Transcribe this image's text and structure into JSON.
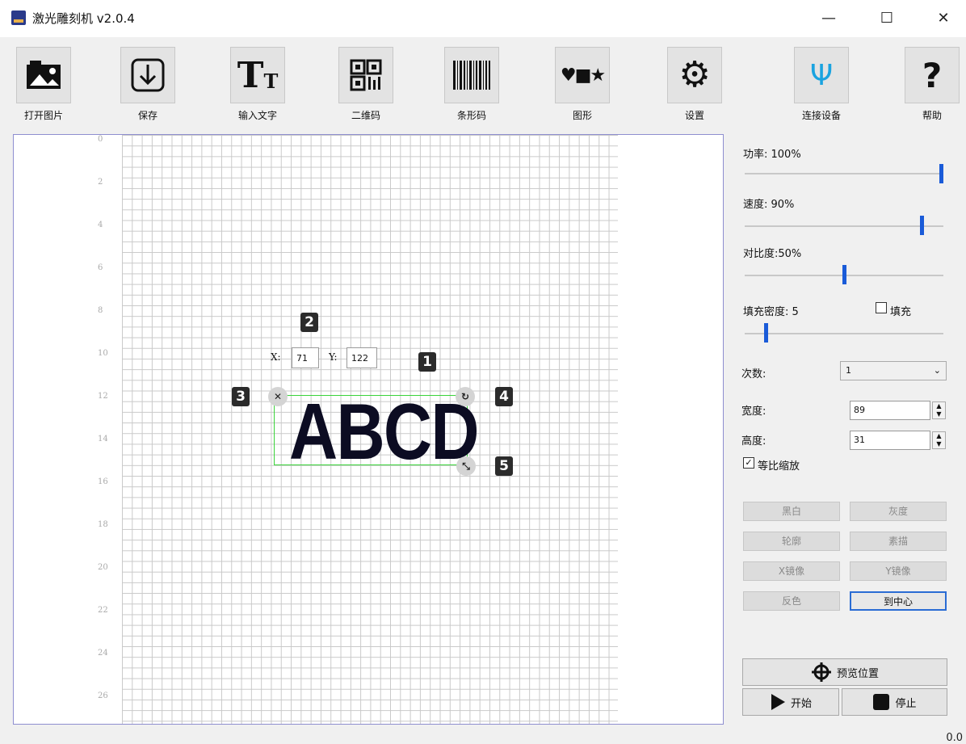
{
  "window": {
    "title": "激光雕刻机 v2.0.4",
    "minimize": "—",
    "maximize": "☐",
    "close": "✕"
  },
  "toolbar": [
    {
      "label": "打开图片",
      "icon": "open-image-icon"
    },
    {
      "label": "保存",
      "icon": "save-download-icon"
    },
    {
      "label": "输入文字",
      "icon": "text-icon"
    },
    {
      "label": "二维码",
      "icon": "qrcode-icon"
    },
    {
      "label": "条形码",
      "icon": "barcode-icon"
    },
    {
      "label": "图形",
      "icon": "shapes-icon"
    },
    {
      "label": "设置",
      "icon": "gear-icon"
    },
    {
      "label": "连接设备",
      "icon": "usb-icon"
    },
    {
      "label": "帮助",
      "icon": "help-icon"
    }
  ],
  "icon_glyphs": {
    "text": "T",
    "text_small": "T",
    "help": "?",
    "usb": "Ψ",
    "gear": "⚙",
    "shapes": "♥■★"
  },
  "canvas": {
    "ruler": [
      "0",
      "2",
      "4",
      "6",
      "8",
      "10",
      "12",
      "14",
      "16",
      "18",
      "20",
      "22",
      "24",
      "26"
    ],
    "coord": {
      "x_label": "X:",
      "x_value": "71",
      "y_label": "Y:",
      "y_value": "122"
    },
    "object_text": "ABCD",
    "handles": {
      "delete": "✕",
      "rotate": "↻",
      "resize": "⤡"
    },
    "markers": [
      "1",
      "2",
      "3",
      "4",
      "5"
    ]
  },
  "panel": {
    "power": {
      "label": "功率: 100%",
      "value": 100
    },
    "speed": {
      "label": "速度: 90%",
      "value": 90
    },
    "contrast": {
      "label": "对比度:50%",
      "value": 50
    },
    "fill_density": {
      "label": "填充密度: 5",
      "value": 5,
      "max": 50
    },
    "fill": {
      "label": "填充",
      "checked": false
    },
    "passes": {
      "label": "次数:",
      "value": "1"
    },
    "width": {
      "label": "宽度:",
      "value": "89"
    },
    "height": {
      "label": "高度:",
      "value": "31"
    },
    "proportional": {
      "label": "等比缩放",
      "checked": true,
      "mark": "✓"
    },
    "buttons": [
      "黑白",
      "灰度",
      "轮廓",
      "素描",
      "X镜像",
      "Y镜像",
      "反色",
      "到中心"
    ],
    "preview": "预览位置",
    "start": "开始",
    "stop": "停止"
  },
  "status_corner": "0.0",
  "colors": {
    "accent": "#1a5bd8",
    "selection": "#3ad43a",
    "marker": "#2b2b2b"
  }
}
